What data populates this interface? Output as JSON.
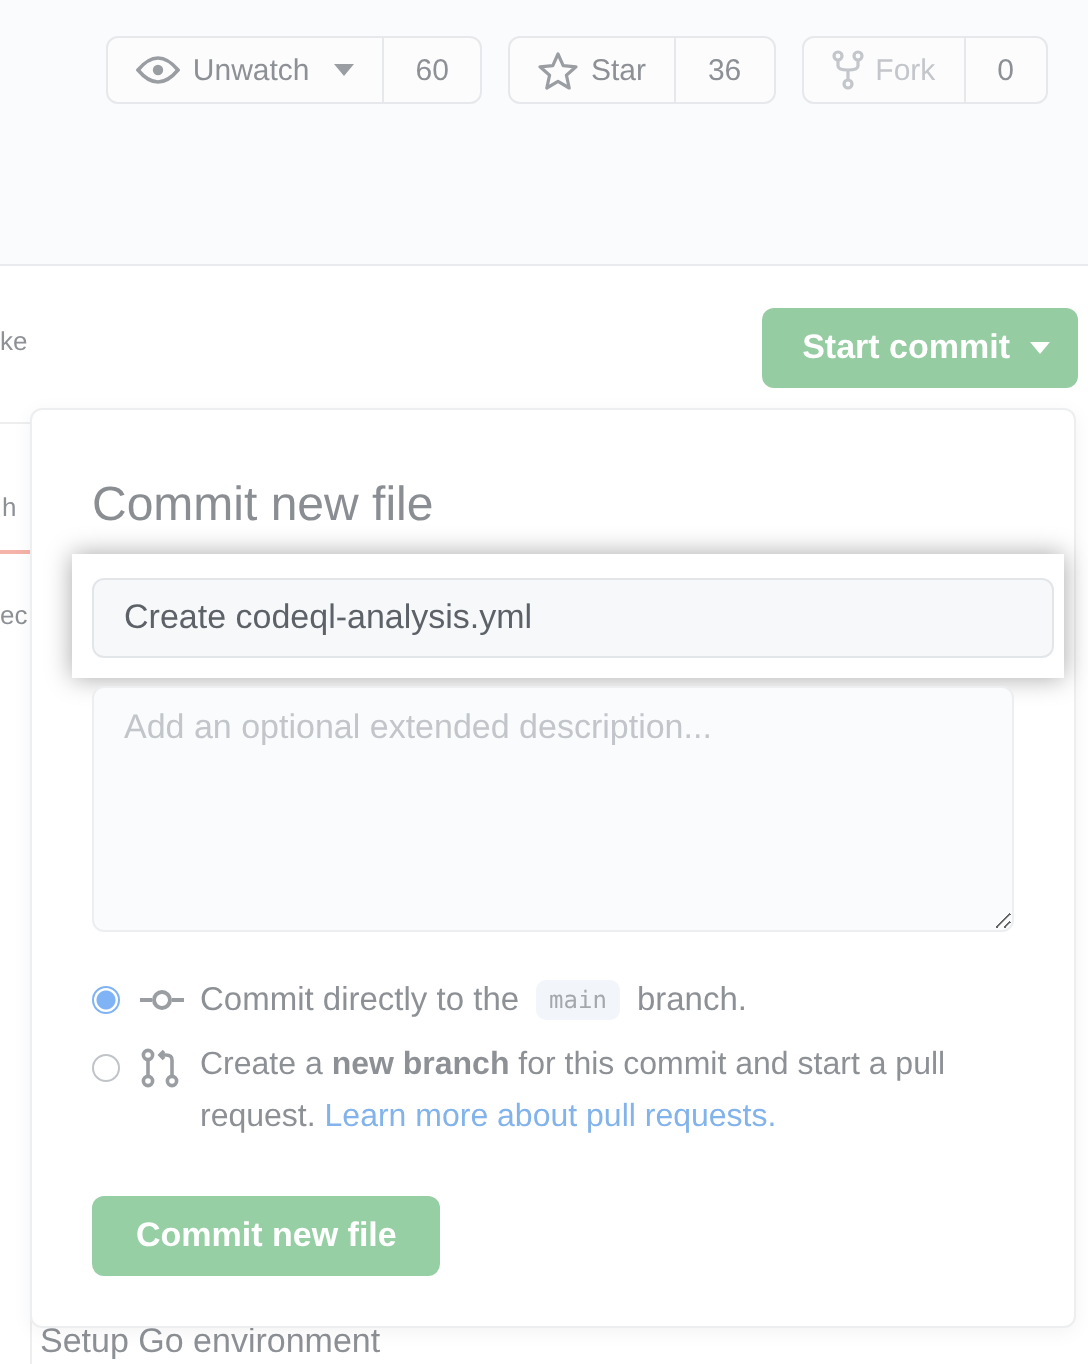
{
  "header": {
    "actions": [
      {
        "kind": "watch",
        "label": "Unwatch",
        "count": "60",
        "disabled": false
      },
      {
        "kind": "star",
        "label": "Star",
        "count": "36",
        "disabled": false
      },
      {
        "kind": "fork",
        "label": "Fork",
        "count": "0",
        "disabled": true
      }
    ]
  },
  "start_commit": {
    "label": "Start commit"
  },
  "background": {
    "fragments": [
      "ke",
      "h",
      "ec"
    ],
    "list_item": "Setup Go environment"
  },
  "commit_form": {
    "title": "Commit new file",
    "summary": {
      "value": "Create codeql-analysis.yml"
    },
    "description": {
      "placeholder": "Add an optional extended description..."
    },
    "options": [
      {
        "kind": "direct",
        "selected": true,
        "text": "Commit directly to the",
        "branch": "main",
        "text_after": "branch."
      },
      {
        "kind": "new-branch",
        "selected": false,
        "text": "Create a **new branch** for this commit and start a pull request.",
        "link": "Learn more about pull requests."
      }
    ],
    "submit": "Commit new file"
  }
}
